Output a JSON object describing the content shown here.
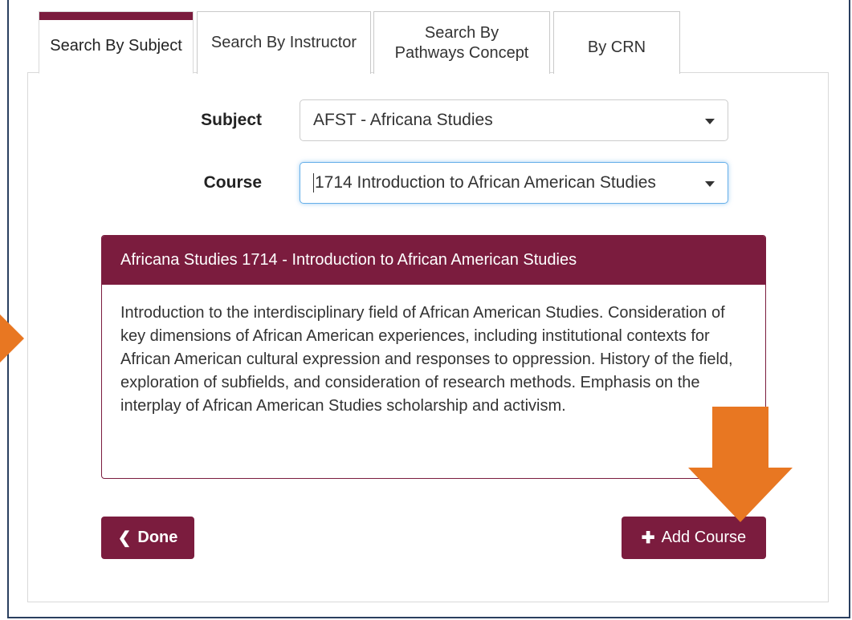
{
  "tabs": [
    {
      "label": "Search By Subject"
    },
    {
      "label": "Search By Instructor"
    },
    {
      "label": "Search By Pathways Concept"
    },
    {
      "label": "By CRN"
    }
  ],
  "form": {
    "subject_label": "Subject",
    "subject_value": "AFST - Africana Studies",
    "course_label": "Course",
    "course_value": "1714 Introduction to African American Studies"
  },
  "course_card": {
    "title": "Africana Studies 1714 - Introduction to African American Studies",
    "description": "Introduction to the interdisciplinary field of African American Studies. Consideration of key dimensions of African American experiences, including institutional contexts for African American cultural expression and responses to oppression. History of the field, exploration of subfields, and consideration of research methods. Emphasis on the interplay of African American Studies scholarship and activism."
  },
  "buttons": {
    "done_label": "Done",
    "add_course_label": "Add Course"
  },
  "icons": {
    "done": "chevron-left-icon",
    "add": "plus-icon"
  },
  "colors": {
    "brand": "#7b1c3e",
    "highlight_arrow": "#e87722"
  }
}
